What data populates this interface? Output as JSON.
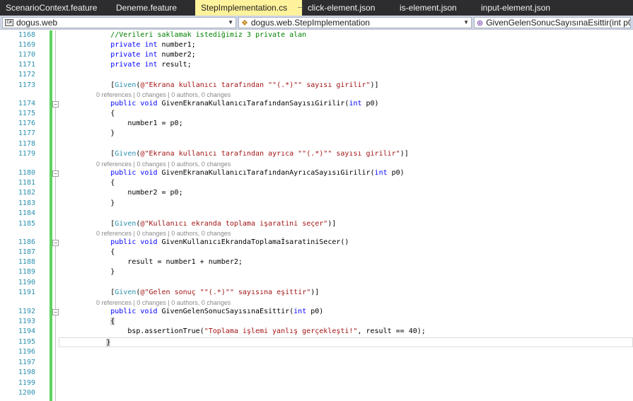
{
  "tabs": [
    {
      "label": "ScenarioContext.feature",
      "active": false
    },
    {
      "label": "Deneme.feature",
      "active": false
    },
    {
      "label": "StepImplementation.cs",
      "active": true
    },
    {
      "label": "click-element.json",
      "active": false
    },
    {
      "label": "is-element.json",
      "active": false
    },
    {
      "label": "input-element.json",
      "active": false
    }
  ],
  "tab_icons": {
    "pin": "pin-icon",
    "close": "close-icon"
  },
  "nav": {
    "project": "dogus.web",
    "class": "dogus.web.StepImplementation",
    "member": "GivenGelenSonucSayısınaEsittir(int p0)"
  },
  "line_numbers": [
    "1168",
    "1169",
    "1170",
    "1171",
    "1172",
    "1173",
    "1174",
    "1175",
    "1176",
    "1177",
    "1178",
    "1179",
    "1180",
    "1181",
    "1182",
    "1183",
    "1184",
    "1185",
    "1186",
    "1187",
    "1188",
    "1189",
    "1190",
    "1191",
    "1192",
    "1193",
    "1194",
    "1195",
    "1196",
    "1197",
    "1198",
    "1199",
    "1200"
  ],
  "codelens": "0 references | 0 changes | 0 authors, 0 changes",
  "code": {
    "comment": "//Verileri saklamak istediğimiz 3 private alan",
    "private_kw": "private",
    "int_kw": "int",
    "public_kw": "public",
    "void_kw": "void",
    "given_attr": "Given",
    "field1": " number1;",
    "field2": " number2;",
    "field3": " result;",
    "step1_pattern": "@\"Ekrana kullanıcı tarafından \"\"(.*)\"\" sayısı girilir\"",
    "step1_method": " GivenEkranaKullanıcıTarafındanSayısıGirilir(",
    "step1_body": "number1 = p0;",
    "step2_pattern": "@\"Ekrana kullanıcı tarafından ayrıca \"\"(.*)\"\" sayısı girilir\"",
    "step2_method": " GivenEkranaKullanıcıTarafındanAyrıcaSayısıGirilir(",
    "step2_body": "number2 = p0;",
    "step3_pattern": "@\"Kullanıcı ekranda toplama işaratini seçer\"",
    "step3_method": " GivenKullanıcıEkrandaToplamaİsaratiniSecer()",
    "step3_body": "result = number1 + number2;",
    "step4_pattern": "@\"Gelen sonuç \"\"(.*)\"\" sayısına eşittir\"",
    "step4_method": " GivenGelenSonucSayısınaEsittir(",
    "step4_body_pre": "bsp.assertionTrue(",
    "step4_body_str": "\"Toplama işlemi yanlış gerçekleşti!\"",
    "step4_body_post": ", result == 40);",
    "param": " p0)",
    "open_brace": "{",
    "close_brace": "}"
  }
}
